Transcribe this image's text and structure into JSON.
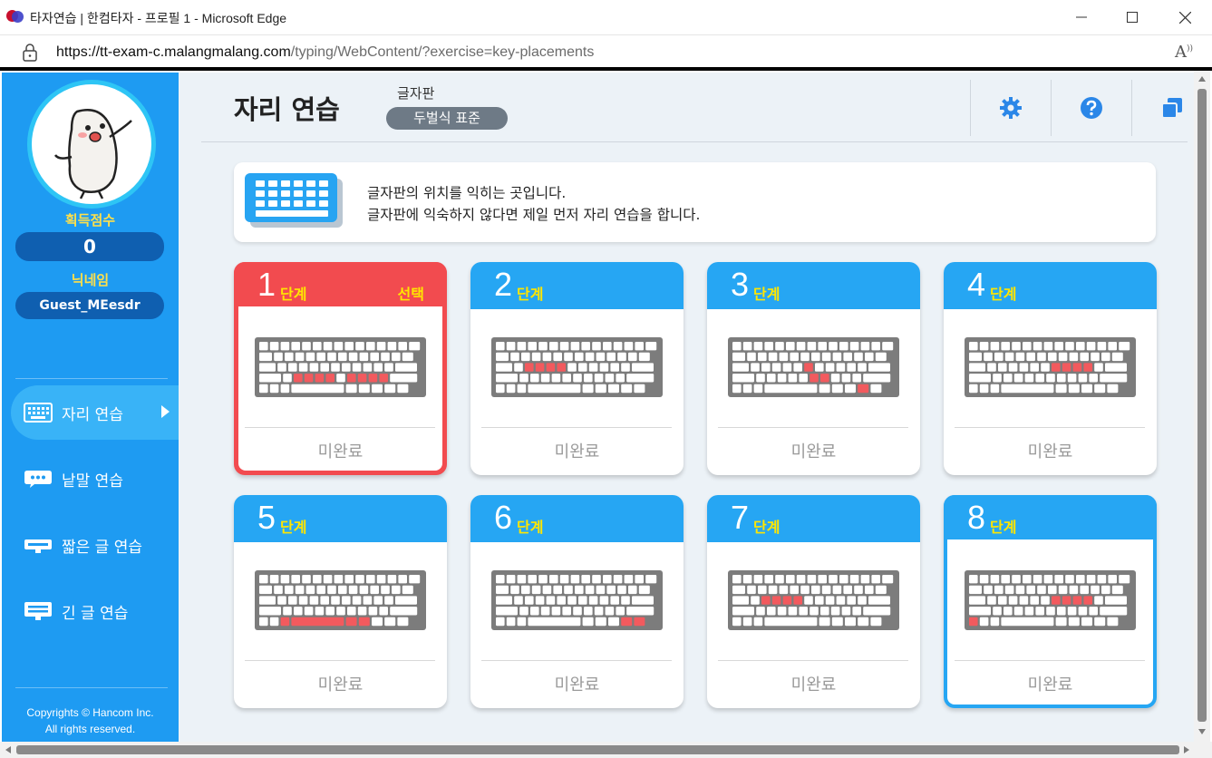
{
  "window": {
    "title": "타자연습 | 한컴타자 - 프로필 1 - Microsoft Edge",
    "url_host": "https://tt-exam-c.malangmalang.com",
    "url_rest": "/typing/WebContent/?exercise=key-placements"
  },
  "sidebar": {
    "score_label": "획득점수",
    "score_value": "0",
    "nickname_label": "닉네임",
    "nickname_value": "Guest_MEesdr",
    "nav": [
      {
        "label": "자리 연습",
        "icon": "keyboard-icon"
      },
      {
        "label": "낱말 연습",
        "icon": "speech-bubble-icon"
      },
      {
        "label": "짧은 글 연습",
        "icon": "short-text-icon"
      },
      {
        "label": "긴 글 연습",
        "icon": "long-text-icon"
      }
    ],
    "copyright_line1": "Copyrights © Hancom Inc.",
    "copyright_line2": "All rights reserved."
  },
  "header": {
    "title": "자리 연습",
    "keyboard_label": "글자판",
    "keyboard_value": "두벌식 표준"
  },
  "info": {
    "line1": "글자판의 위치를 익히는 곳입니다.",
    "line2": "글자판에 익숙하지 않다면 제일 먼저 자리 연습을 합니다."
  },
  "stage_word": "단계",
  "selected_tag": "선택",
  "stages": [
    {
      "num": "1",
      "status": "미완료",
      "keys": [
        [
          2,
          2
        ],
        [
          2,
          3
        ],
        [
          2,
          4
        ],
        [
          2,
          5
        ],
        [
          2,
          7
        ],
        [
          2,
          8
        ],
        [
          2,
          9
        ],
        [
          2,
          10
        ]
      ]
    },
    {
      "num": "2",
      "status": "미완료",
      "keys": [
        [
          1,
          2
        ],
        [
          1,
          3
        ],
        [
          1,
          4
        ],
        [
          1,
          5
        ]
      ]
    },
    {
      "num": "3",
      "status": "미완료",
      "keys": [
        [
          1,
          6
        ],
        [
          2,
          6
        ],
        [
          2,
          7
        ],
        [
          3,
          7
        ]
      ]
    },
    {
      "num": "4",
      "status": "미완료",
      "keys": [
        [
          1,
          7
        ],
        [
          1,
          8
        ],
        [
          1,
          9
        ],
        [
          1,
          10
        ]
      ]
    },
    {
      "num": "5",
      "status": "미완료",
      "keys": [
        [
          3,
          2
        ],
        [
          3,
          3
        ],
        [
          3,
          4
        ],
        [
          3,
          5
        ]
      ]
    },
    {
      "num": "6",
      "status": "미완료",
      "keys": [
        [
          3,
          7
        ],
        [
          3,
          8
        ],
        [
          3,
          9
        ],
        [
          3,
          10
        ]
      ]
    },
    {
      "num": "7",
      "status": "미완료",
      "keys": [
        [
          1,
          2
        ],
        [
          1,
          3
        ],
        [
          1,
          4
        ],
        [
          1,
          5
        ],
        [
          3,
          12
        ]
      ]
    },
    {
      "num": "8",
      "status": "미완료",
      "keys": [
        [
          1,
          7
        ],
        [
          1,
          8
        ],
        [
          1,
          9
        ],
        [
          1,
          10
        ],
        [
          3,
          0
        ]
      ]
    }
  ],
  "colors": {
    "sidebar_bg": "#1e9bf2",
    "card_header": "#26a6f3",
    "selected_card": "#f24b4f",
    "highlight_key": "#f25a5e",
    "yellow_text": "#ffe600"
  }
}
